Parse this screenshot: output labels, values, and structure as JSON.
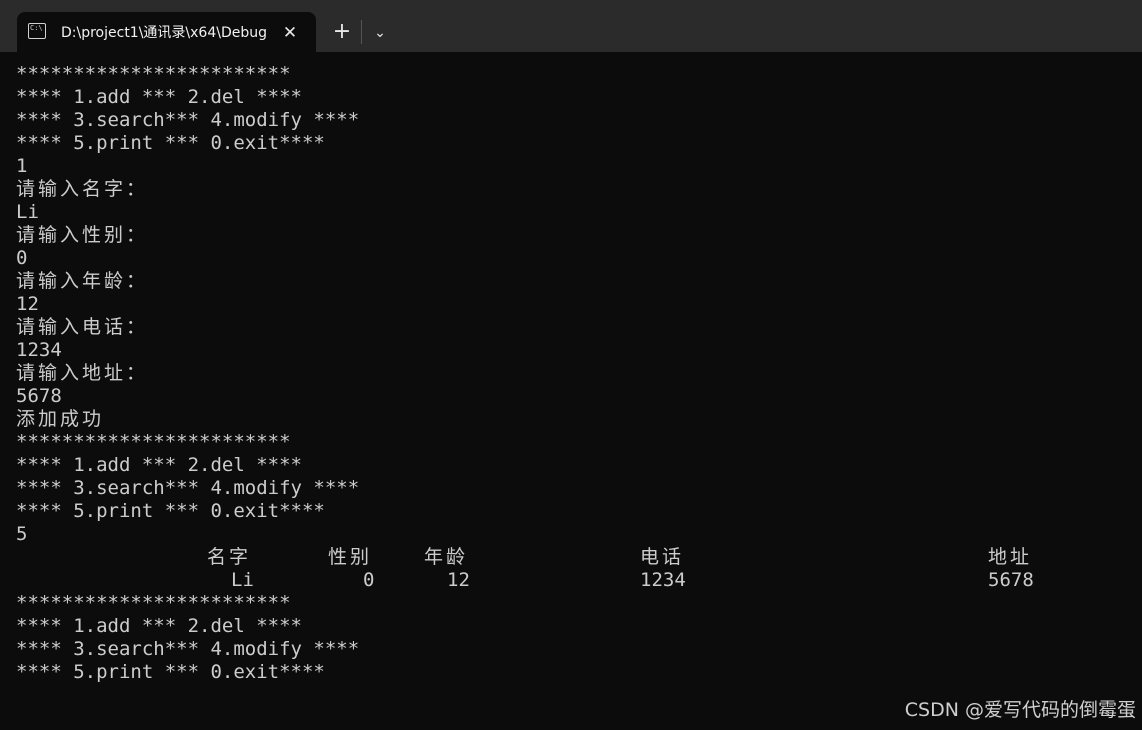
{
  "window": {
    "tab_title": "D:\\project1\\通讯录\\x64\\Debug",
    "tab_close": "✕",
    "new_tab": "+",
    "dropdown": "⌄"
  },
  "menu": [
    "************************",
    "**** 1.add *** 2.del ****",
    "**** 3.search*** 4.modify ****",
    "**** 5.print *** 0.exit****"
  ],
  "session_add": [
    "1",
    "请输入名字：",
    "Li",
    "请输入性别：",
    "0",
    "请输入年龄：",
    "12",
    "请输入电话：",
    "1234",
    "请输入地址：",
    "5678",
    "添加成功"
  ],
  "choice_print": "5",
  "table": {
    "headers": [
      "名字",
      "性别",
      "年龄",
      "电话",
      "地址"
    ],
    "row": [
      "Li",
      "0",
      "12",
      "1234",
      "5678"
    ]
  },
  "watermark": "CSDN @爱写代码的倒霉蛋"
}
